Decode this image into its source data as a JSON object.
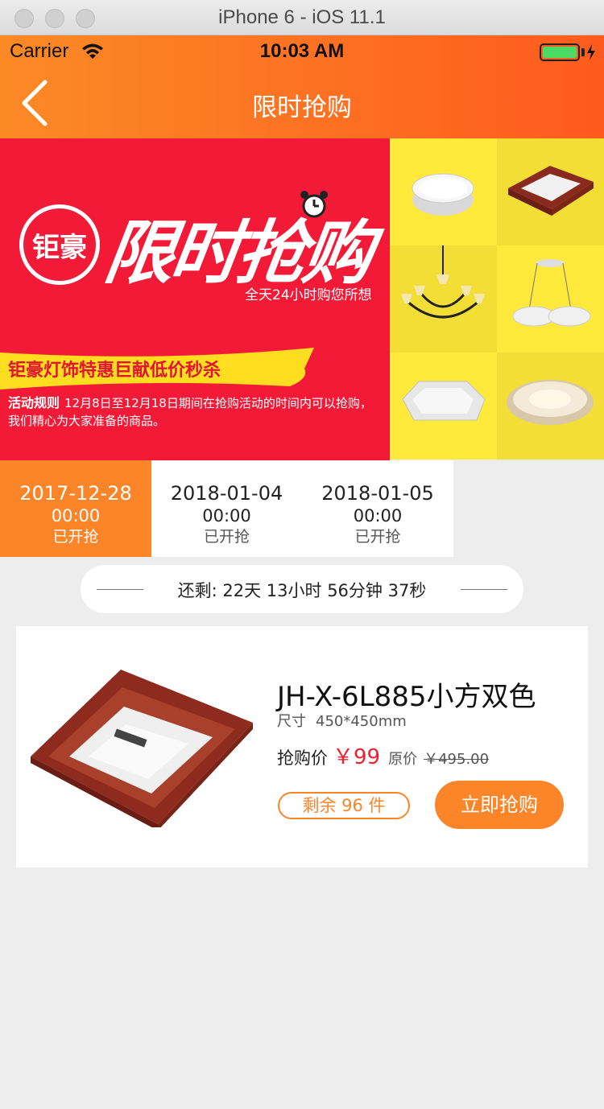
{
  "simulator": {
    "title": "iPhone 6 - iOS 11.1"
  },
  "status_bar": {
    "carrier": "Carrier",
    "time": "10:03 AM"
  },
  "nav": {
    "title": "限时抢购",
    "back_icon": "chevron-left-icon"
  },
  "banner": {
    "logo_text": "钜豪",
    "headline": "限时抢购",
    "slogan": "全天24小时购您所想",
    "ribbon": "钜豪灯饰特惠巨献低价秒杀",
    "rules_title": "活动规则",
    "rules_text": "12月8日至12月18日期间在抢购活动的时间内可以抢购，我们精心为大家准备的商品。",
    "colors": {
      "red": "#f21a36",
      "yellow": "#ffeb3b"
    }
  },
  "tabs": [
    {
      "date": "2017-12-28",
      "time": "00:00",
      "state": "已开抢",
      "active": true
    },
    {
      "date": "2018-01-04",
      "time": "00:00",
      "state": "已开抢",
      "active": false
    },
    {
      "date": "2018-01-05",
      "time": "00:00",
      "state": "已开抢",
      "active": false
    }
  ],
  "countdown": {
    "text": "还剩: 22天 13小时 56分钟 37秒"
  },
  "product": {
    "name": "JH-X-6L885小方双色",
    "size_label": "尺寸",
    "size_value": "450*450mm",
    "price_label": "抢购价",
    "price": "￥99",
    "original_label": "原价",
    "original_price": "￥495.00",
    "stock": "剩余 96 件",
    "buy_label": "立即抢购"
  },
  "accent_color": "#fb8528"
}
